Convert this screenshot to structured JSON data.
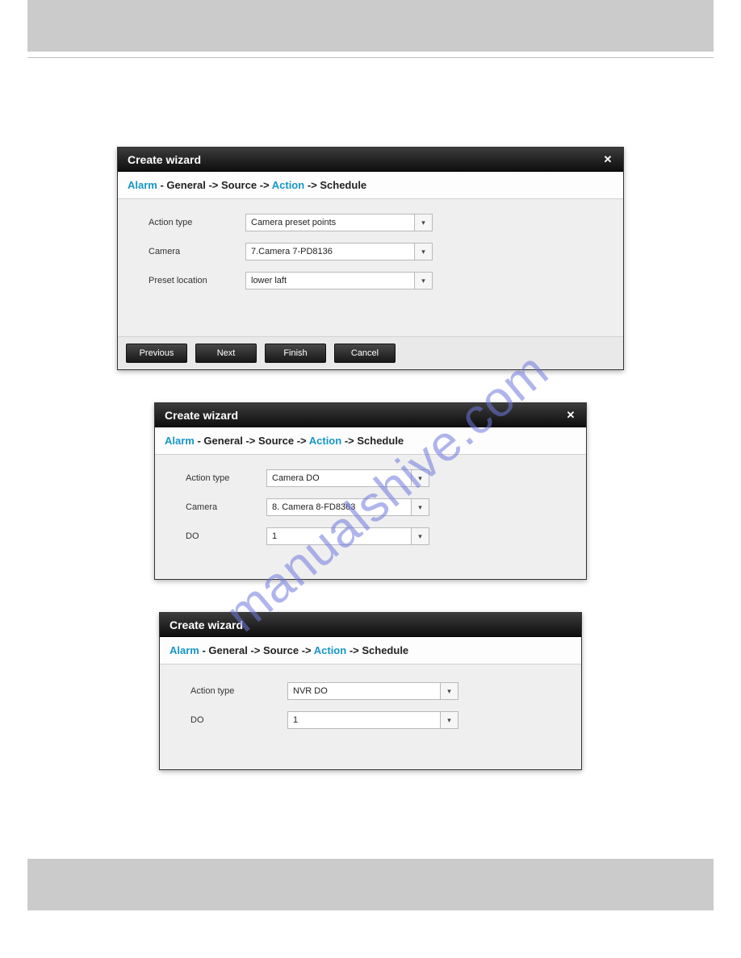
{
  "watermark": "manualshive.com",
  "dialog1": {
    "title": "Create wizard",
    "breadcrumb": {
      "alarm": "Alarm",
      "general": "General",
      "source": "Source",
      "action": "Action",
      "schedule": "Schedule",
      "sep": " -> ",
      "dash": " - "
    },
    "fields": {
      "action_type_label": "Action type",
      "action_type_value": "Camera preset points",
      "camera_label": "Camera",
      "camera_value": "7.Camera 7-PD8136",
      "preset_label": "Preset location",
      "preset_value": "lower laft"
    },
    "buttons": {
      "previous": "Previous",
      "next": "Next",
      "finish": "Finish",
      "cancel": "Cancel"
    }
  },
  "dialog2": {
    "title": "Create wizard",
    "breadcrumb": {
      "alarm": "Alarm",
      "general": "General",
      "source": "Source",
      "action": "Action",
      "schedule": "Schedule",
      "sep": " -> ",
      "dash": " - "
    },
    "fields": {
      "action_type_label": "Action type",
      "action_type_value": "Camera DO",
      "camera_label": "Camera",
      "camera_value": "8. Camera 8-FD8363",
      "do_label": "DO",
      "do_value": "1"
    }
  },
  "dialog3": {
    "title": "Create wizard",
    "breadcrumb": {
      "alarm": "Alarm",
      "general": "General",
      "source": "Source",
      "action": "Action",
      "schedule": "Schedule",
      "sep": " -> ",
      "dash": " - "
    },
    "fields": {
      "action_type_label": "Action type",
      "action_type_value": "NVR DO",
      "do_label": "DO",
      "do_value": "1"
    }
  }
}
